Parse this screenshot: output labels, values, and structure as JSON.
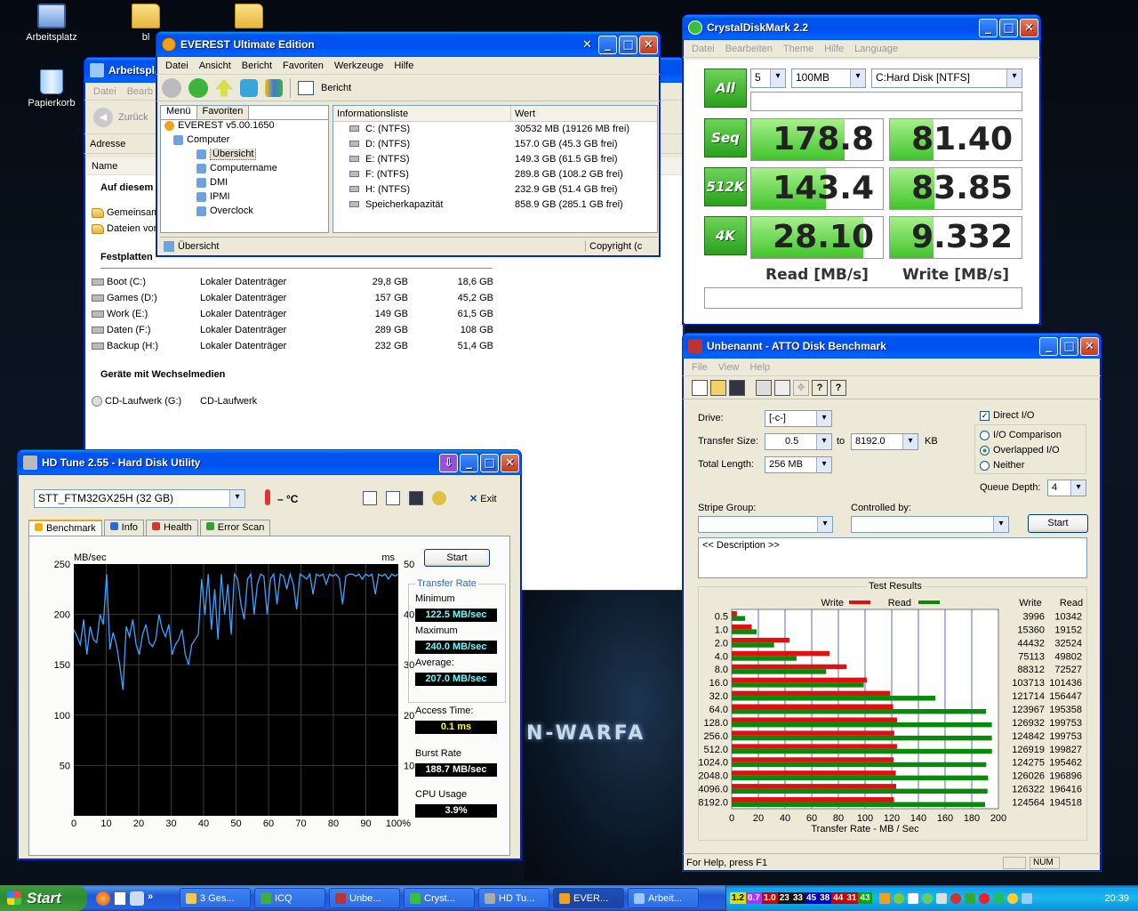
{
  "desktop": {
    "icons": [
      {
        "label": "Arbeitsplatz"
      },
      {
        "label": "bl"
      },
      {
        "label": "Papierkorb"
      }
    ],
    "wallpaper_text": "N-WARFA"
  },
  "explorer": {
    "title": "Arbeitspla",
    "menu": [
      "Datei",
      "Bearb"
    ],
    "back": "Zurück",
    "address": "Adresse",
    "col_name": "Name",
    "sec_local": "Auf diesem",
    "local_items": [
      "Gemeinsam",
      "Dateien vor"
    ],
    "sec_disks": "Festplatten",
    "disks": [
      {
        "name": "Boot (C:)",
        "type": "Lokaler Datenträger",
        "size": "29,8 GB",
        "free": "18,6 GB"
      },
      {
        "name": "Games (D:)",
        "type": "Lokaler Datenträger",
        "size": "157 GB",
        "free": "45,2 GB"
      },
      {
        "name": "Work (E:)",
        "type": "Lokaler Datenträger",
        "size": "149 GB",
        "free": "61,5 GB"
      },
      {
        "name": "Daten (F:)",
        "type": "Lokaler Datenträger",
        "size": "289 GB",
        "free": "108 GB"
      },
      {
        "name": "Backup (H:)",
        "type": "Lokaler Datenträger",
        "size": "232 GB",
        "free": "51,4 GB"
      }
    ],
    "sec_removable": "Geräte mit Wechselmedien",
    "cd": {
      "name": "CD-Laufwerk (G:)",
      "type": "CD-Laufwerk"
    }
  },
  "everest": {
    "title": "EVEREST Ultimate Edition",
    "menu": [
      "Datei",
      "Ansicht",
      "Bericht",
      "Favoriten",
      "Werkzeuge",
      "Hilfe"
    ],
    "report": "Bericht",
    "tabs": [
      "Menü",
      "Favoriten"
    ],
    "tree": [
      "EVEREST v5.00.1650",
      "Computer",
      "Übersicht",
      "Computername",
      "DMI",
      "IPMI",
      "Overclock"
    ],
    "col_info": "Informationsliste",
    "col_value": "Wert",
    "rows": [
      {
        "k": "C: (NTFS)",
        "v": "30532 MB (19126 MB frei)"
      },
      {
        "k": "D: (NTFS)",
        "v": "157.0 GB (45.3 GB frei)"
      },
      {
        "k": "E: (NTFS)",
        "v": "149.3 GB (61.5 GB frei)"
      },
      {
        "k": "F: (NTFS)",
        "v": "289.8 GB (108.2 GB frei)"
      },
      {
        "k": "H: (NTFS)",
        "v": "232.9 GB (51.4 GB frei)"
      },
      {
        "k": "Speicherkapazität",
        "v": "858.9 GB (285.1 GB frei)"
      }
    ],
    "status": "Übersicht",
    "copyright": "Copyright (c"
  },
  "cdm": {
    "title": "CrystalDiskMark 2.2",
    "menu": [
      "Datei",
      "Bearbeiten",
      "Theme",
      "Hilfe",
      "Language"
    ],
    "all": "All",
    "runs": "5",
    "size": "100MB",
    "drive": "C:Hard Disk [NTFS]",
    "rows": [
      {
        "label": "Seq",
        "read": "178.8",
        "write": "81.40",
        "read_frac": 0.71,
        "write_frac": 0.33
      },
      {
        "label": "512K",
        "read": "143.4",
        "write": "83.85",
        "read_frac": 0.57,
        "write_frac": 0.34
      },
      {
        "label": "4K",
        "read": "28.10",
        "write": "9.332",
        "read_frac": 0.85,
        "write_frac": 0.33
      }
    ],
    "read_label": "Read [MB/s]",
    "write_label": "Write [MB/s]"
  },
  "atto": {
    "title": "Unbenannt - ATTO Disk Benchmark",
    "menu": [
      "File",
      "View",
      "Help"
    ],
    "drive_label": "Drive:",
    "drive": "[-c-]",
    "ts_label": "Transfer Size:",
    "ts_from": "0.5",
    "to": "to",
    "ts_to": "8192.0",
    "kb": "KB",
    "tl_label": "Total Length:",
    "tl": "256 MB",
    "direct_io": "Direct I/O",
    "opt1": "I/O Comparison",
    "opt2": "Overlapped I/O",
    "opt3": "Neither",
    "qd_label": "Queue Depth:",
    "qd": "4",
    "stripe": "Stripe Group:",
    "controlled": "Controlled by:",
    "start": "Start",
    "desc": "<< Description >>",
    "results": "Test Results",
    "legend_write": "Write",
    "legend_read": "Read",
    "col_write": "Write",
    "col_read": "Read",
    "xlabel": "Transfer Rate - MB / Sec",
    "status": "For Help, press F1",
    "num": "NUM"
  },
  "hdtune": {
    "title": "HD Tune 2.55 - Hard Disk Utility",
    "drive": "STT_FTM32GX25H (32 GB)",
    "temp": "– °C",
    "exit": "Exit",
    "tabs": [
      "Benchmark",
      "Info",
      "Health",
      "Error Scan"
    ],
    "start": "Start",
    "unit_left": "MB/sec",
    "unit_right": "ms",
    "transfer_rate": "Transfer Rate",
    "min_label": "Minimum",
    "min": "122.5 MB/sec",
    "max_label": "Maximum",
    "max": "240.0 MB/sec",
    "avg_label": "Average:",
    "avg": "207.0 MB/sec",
    "access_label": "Access Time:",
    "access": "0.1 ms",
    "burst_label": "Burst Rate",
    "burst": "188.7 MB/sec",
    "cpu_label": "CPU Usage",
    "cpu": "3.9%"
  },
  "chart_data": [
    {
      "type": "line",
      "title": "",
      "xlabel": "",
      "ylabel": "MB/sec",
      "y2label": "ms",
      "xlim": [
        0,
        100
      ],
      "ylim": [
        0,
        250
      ],
      "y2lim": [
        0,
        50
      ],
      "x_ticks": [
        "0",
        "10",
        "20",
        "30",
        "40",
        "50",
        "60",
        "70",
        "80",
        "90",
        "100%"
      ],
      "y_ticks": [
        "250",
        "200",
        "150",
        "100",
        "50"
      ],
      "y2_ticks": [
        "50",
        "40",
        "30",
        "20",
        "10"
      ],
      "series": [
        {
          "values": [
            185,
            178,
            170,
            195,
            160,
            188,
            175,
            172,
            200,
            190,
            240,
            165,
            182,
            170,
            150,
            125,
            188,
            178,
            195,
            170,
            160,
            180,
            190,
            172,
            168,
            175,
            200,
            185,
            178,
            190,
            160,
            170,
            175,
            185,
            160,
            150,
            170,
            175,
            180,
            235,
            200,
            240,
            185,
            225,
            175,
            240,
            200,
            230,
            180,
            240,
            235,
            210,
            195,
            235,
            240,
            200,
            230,
            240,
            238,
            200,
            235,
            240,
            210,
            240,
            238,
            225,
            240,
            230,
            205,
            240,
            238,
            235,
            240,
            220,
            240,
            238,
            240,
            230,
            240,
            238,
            240,
            236,
            210,
            238,
            240,
            240,
            238,
            240,
            235,
            240,
            238,
            240,
            220,
            240,
            238,
            240,
            235,
            240,
            238,
            240
          ]
        }
      ]
    },
    {
      "type": "bar",
      "title": "Test Results",
      "xlabel": "Transfer Rate - MB / Sec",
      "xlim": [
        0,
        200
      ],
      "categories": [
        "0.5",
        "1.0",
        "2.0",
        "4.0",
        "8.0",
        "16.0",
        "32.0",
        "64.0",
        "128.0",
        "256.0",
        "512.0",
        "1024.0",
        "2048.0",
        "4096.0",
        "8192.0"
      ],
      "series": [
        {
          "name": "Write",
          "color": "#e01010",
          "values": [
            3996,
            15360,
            44432,
            75113,
            88312,
            103713,
            121714,
            123967,
            126932,
            124842,
            126919,
            124275,
            126026,
            126322,
            124564
          ]
        },
        {
          "name": "Read",
          "color": "#0a8a0a",
          "values": [
            10342,
            19152,
            32524,
            49802,
            72527,
            101436,
            156447,
            195358,
            199753,
            199753,
            199827,
            195462,
            196896,
            196416,
            194518
          ]
        }
      ]
    }
  ],
  "taskbar": {
    "start": "Start",
    "tasks": [
      "3 Ges...",
      "ICQ",
      "Unbe...",
      "Cryst...",
      "HD Tu...",
      "EVER...",
      "Arbeit..."
    ],
    "tray": [
      "1.2",
      "0.7",
      "1.0",
      "23",
      "33",
      "45",
      "38",
      "44",
      "31",
      "43"
    ],
    "clock": "20:39"
  }
}
